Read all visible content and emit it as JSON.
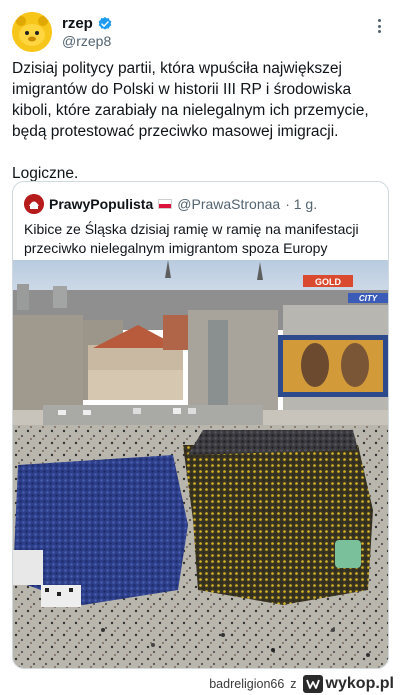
{
  "author": {
    "display_name": "rzep",
    "handle": "@rzep8",
    "verified": true
  },
  "tweet": {
    "text": "Dzisiaj politycy partii, która wpuściła największej imigrantów do Polski w historii III RP i środowiska kiboli, które zarabiały na nielegalnym ich przemycie, będą protestować przeciwko masowej imigracji.\n\nLogiczne."
  },
  "quote": {
    "display_name": "PrawyPopulista",
    "handle": "@PrawaStronaa",
    "time": "· 1 g.",
    "text": "Kibice ze Śląska dzisiaj ramię w ramię na manifestacji przeciwko nielegalnym imigrantom spoza Europy",
    "image_signs": {
      "top": "GOLD",
      "right": "CITY"
    }
  },
  "watermark": {
    "user": "badreligion66",
    "sep": "z",
    "brand": "wykop.pl"
  },
  "colors": {
    "text": "#0f1419",
    "muted": "#536471",
    "border": "#cfd9de",
    "verified": "#1d9bf0"
  },
  "icons": [
    "verified-badge-icon",
    "more-options-icon",
    "poland-flag-icon",
    "wykop-logo-icon"
  ]
}
